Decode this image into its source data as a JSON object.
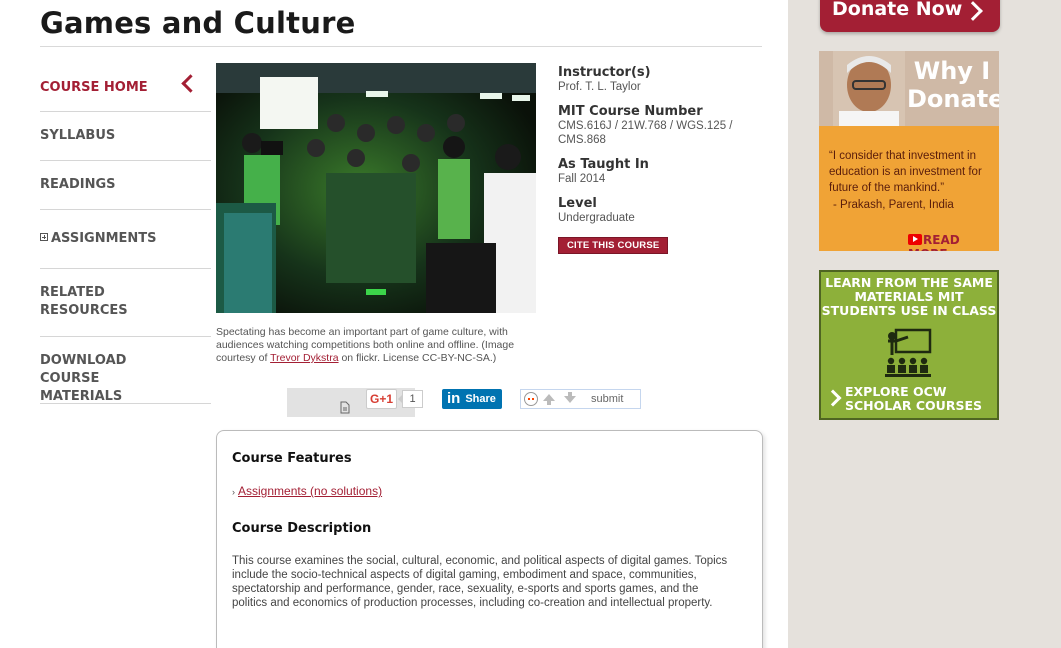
{
  "page": {
    "title": "Games and Culture"
  },
  "sidebar": {
    "items": [
      {
        "label": "COURSE HOME",
        "active": true
      },
      {
        "label": "SYLLABUS"
      },
      {
        "label": "READINGS"
      },
      {
        "label": "ASSIGNMENTS"
      },
      {
        "label": "RELATED RESOURCES"
      },
      {
        "label": "DOWNLOAD COURSE MATERIALS"
      }
    ]
  },
  "photo": {
    "caption_prefix": "Spectating has become an important part of game culture, with audiences watching competitions both online and offline. (Image courtesy of",
    "caption_link": "Trevor Dykstra",
    "caption_suffix": "on flickr. License CC-BY-NC-SA.)"
  },
  "course_info": {
    "instructor_label": "Instructor(s)",
    "instructor": "Prof. T. L. Taylor",
    "number_label": "MIT Course Number",
    "number": "CMS.616J / 21W.768 / WGS.125 / CMS.868",
    "taught_label": "As Taught In",
    "taught": "Fall 2014",
    "level_label": "Level",
    "level": "Undergraduate",
    "cite_button": "CITE THIS COURSE"
  },
  "share": {
    "gplus_label": "G+1",
    "gplus_count": "1",
    "linkedin_label": "Share",
    "reddit_submit": "submit"
  },
  "features": {
    "heading": "Course Features",
    "items": [
      "Assignments (no solutions)"
    ],
    "description_heading": "Course Description",
    "description": "This course examines the social, cultural, economic, and political aspects of digital games. Topics include the socio-technical aspects of digital gaming, embodiment and space, communities, spectatorship and performance, gender, race, sexuality, e-sports and sports games, and the politics and economics of production processes, including co-creation and intellectual property."
  },
  "sidecol": {
    "donate_label": "Donate Now",
    "why_title": "Why I Donate",
    "why_quote": "“I consider that investment in education is an investment for future of the mankind.”",
    "why_author": "- Prakash, Parent, India",
    "why_more": "READ MORE",
    "learn_top": "LEARN FROM THE SAME MATERIALS MIT STUDENTS USE IN CLASS",
    "learn_bottom": "EXPLORE OCW SCHOLAR COURSES"
  },
  "colors": {
    "accent": "#a31f34",
    "sidebar_bg": "#e5e1dc",
    "scholar_green": "#8db03a",
    "donate_orange": "#f0a336"
  }
}
